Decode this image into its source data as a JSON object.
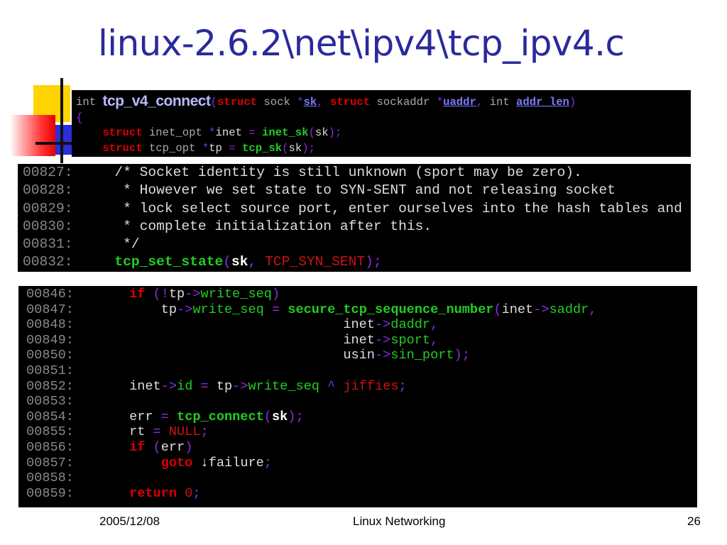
{
  "title": "linux-2.6.2\\net\\ipv4\\tcp_ipv4.c",
  "colors": {
    "title": "#2a2a9c",
    "code_background": "#000000",
    "keyword": "#dd0000",
    "function": "#22cc22",
    "identifier": "#dddddd",
    "operator": "#8a2be2",
    "constant": "#cc1111",
    "comment": "#dddddd",
    "line_number": "#888888",
    "link": "#7a7aff"
  },
  "code_top": {
    "lines": [
      [
        {
          "t": "int ",
          "k": "gray"
        },
        {
          "t": "tcp_v4_connect",
          "k": "fnbig"
        },
        {
          "t": "(",
          "k": "punct"
        },
        {
          "t": "struct",
          "k": "kw"
        },
        {
          "t": " sock ",
          "k": "gray"
        },
        {
          "t": "*",
          "k": "punct"
        },
        {
          "t": "sk",
          "k": "link"
        },
        {
          "t": ", ",
          "k": "punct"
        },
        {
          "t": "struct",
          "k": "kw"
        },
        {
          "t": " sockaddr ",
          "k": "gray"
        },
        {
          "t": "*",
          "k": "punct"
        },
        {
          "t": "uaddr",
          "k": "link"
        },
        {
          "t": ", ",
          "k": "punct"
        },
        {
          "t": "int ",
          "k": "gray"
        },
        {
          "t": "addr_len",
          "k": "link"
        },
        {
          "t": ")",
          "k": "punct"
        }
      ],
      [
        {
          "t": "{",
          "k": "punct"
        }
      ],
      [
        {
          "t": "    ",
          "k": "gray"
        },
        {
          "t": "struct",
          "k": "kw"
        },
        {
          "t": " inet_opt ",
          "k": "gray"
        },
        {
          "t": "*",
          "k": "punct"
        },
        {
          "t": "inet",
          "k": "ident"
        },
        {
          "t": " = ",
          "k": "punct"
        },
        {
          "t": "inet_sk",
          "k": "fn"
        },
        {
          "t": "(",
          "k": "punct"
        },
        {
          "t": "sk",
          "k": "ident"
        },
        {
          "t": ");",
          "k": "punct"
        }
      ],
      [
        {
          "t": "    ",
          "k": "gray"
        },
        {
          "t": "struct",
          "k": "kw"
        },
        {
          "t": " tcp_opt ",
          "k": "gray"
        },
        {
          "t": "*",
          "k": "punct"
        },
        {
          "t": "tp",
          "k": "ident"
        },
        {
          "t": " = ",
          "k": "punct"
        },
        {
          "t": "tcp_sk",
          "k": "fn"
        },
        {
          "t": "(",
          "k": "punct"
        },
        {
          "t": "sk",
          "k": "ident"
        },
        {
          "t": ");",
          "k": "punct"
        }
      ]
    ]
  },
  "code_middle": {
    "lines": [
      [
        {
          "t": "00827:",
          "k": "num"
        },
        {
          "t": "     /* Socket identity is still unknown (sport may be zero).",
          "k": "cmt"
        }
      ],
      [
        {
          "t": "00828:",
          "k": "num"
        },
        {
          "t": "      * However we set state to SYN-SENT and not releasing socket",
          "k": "cmt"
        }
      ],
      [
        {
          "t": "00829:",
          "k": "num"
        },
        {
          "t": "      * lock select source port, enter ourselves into the hash tables and",
          "k": "cmt"
        }
      ],
      [
        {
          "t": "00830:",
          "k": "num"
        },
        {
          "t": "      * complete initialization after this.",
          "k": "cmt"
        }
      ],
      [
        {
          "t": "00831:",
          "k": "num"
        },
        {
          "t": "      */",
          "k": "cmt"
        }
      ],
      [
        {
          "t": "00832:",
          "k": "num"
        },
        {
          "t": "     ",
          "k": "gray"
        },
        {
          "t": "tcp_set_state",
          "k": "fn"
        },
        {
          "t": "(",
          "k": "punct"
        },
        {
          "t": "sk",
          "k": "identw"
        },
        {
          "t": ", ",
          "k": "punct"
        },
        {
          "t": "TCP_SYN_SENT",
          "k": "const"
        },
        {
          "t": ");",
          "k": "punct"
        }
      ]
    ]
  },
  "code_bottom": {
    "lines": [
      [
        {
          "t": "00846:",
          "k": "num"
        },
        {
          "t": "       ",
          "k": "gray"
        },
        {
          "t": "if",
          "k": "kw"
        },
        {
          "t": " (",
          "k": "punct"
        },
        {
          "t": "!",
          "k": "punct"
        },
        {
          "t": "tp",
          "k": "ident"
        },
        {
          "t": "->",
          "k": "op"
        },
        {
          "t": "write_seq",
          "k": "member"
        },
        {
          "t": ")",
          "k": "punct"
        }
      ],
      [
        {
          "t": "00847:",
          "k": "num"
        },
        {
          "t": "           ",
          "k": "gray"
        },
        {
          "t": "tp",
          "k": "ident"
        },
        {
          "t": "->",
          "k": "op"
        },
        {
          "t": "write_seq",
          "k": "member"
        },
        {
          "t": " = ",
          "k": "op"
        },
        {
          "t": "secure_tcp_sequence_number",
          "k": "fn"
        },
        {
          "t": "(",
          "k": "punct"
        },
        {
          "t": "inet",
          "k": "ident"
        },
        {
          "t": "->",
          "k": "op"
        },
        {
          "t": "saddr",
          "k": "member"
        },
        {
          "t": ",",
          "k": "punct"
        }
      ],
      [
        {
          "t": "00848:",
          "k": "num"
        },
        {
          "t": "                                  ",
          "k": "gray"
        },
        {
          "t": "inet",
          "k": "ident"
        },
        {
          "t": "->",
          "k": "op"
        },
        {
          "t": "daddr",
          "k": "member"
        },
        {
          "t": ",",
          "k": "punct"
        }
      ],
      [
        {
          "t": "00849:",
          "k": "num"
        },
        {
          "t": "                                  ",
          "k": "gray"
        },
        {
          "t": "inet",
          "k": "ident"
        },
        {
          "t": "->",
          "k": "op"
        },
        {
          "t": "sport",
          "k": "member"
        },
        {
          "t": ",",
          "k": "punct"
        }
      ],
      [
        {
          "t": "00850:",
          "k": "num"
        },
        {
          "t": "                                  ",
          "k": "gray"
        },
        {
          "t": "usin",
          "k": "ident"
        },
        {
          "t": "->",
          "k": "op"
        },
        {
          "t": "sin_port",
          "k": "member"
        },
        {
          "t": ");",
          "k": "punct"
        }
      ],
      [
        {
          "t": "00851:",
          "k": "num"
        }
      ],
      [
        {
          "t": "00852:",
          "k": "num"
        },
        {
          "t": "       ",
          "k": "gray"
        },
        {
          "t": "inet",
          "k": "ident"
        },
        {
          "t": "->",
          "k": "op"
        },
        {
          "t": "id",
          "k": "member"
        },
        {
          "t": " = ",
          "k": "op"
        },
        {
          "t": "tp",
          "k": "ident"
        },
        {
          "t": "->",
          "k": "op"
        },
        {
          "t": "write_seq",
          "k": "member"
        },
        {
          "t": " ^ ",
          "k": "op"
        },
        {
          "t": "jiffies",
          "k": "const"
        },
        {
          "t": ";",
          "k": "punct"
        }
      ],
      [
        {
          "t": "00853:",
          "k": "num"
        }
      ],
      [
        {
          "t": "00854:",
          "k": "num"
        },
        {
          "t": "       ",
          "k": "gray"
        },
        {
          "t": "err",
          "k": "ident"
        },
        {
          "t": " = ",
          "k": "op"
        },
        {
          "t": "tcp_connect",
          "k": "fn"
        },
        {
          "t": "(",
          "k": "punct"
        },
        {
          "t": "sk",
          "k": "identw"
        },
        {
          "t": ");",
          "k": "punct"
        }
      ],
      [
        {
          "t": "00855:",
          "k": "num"
        },
        {
          "t": "       ",
          "k": "gray"
        },
        {
          "t": "rt",
          "k": "ident"
        },
        {
          "t": " = ",
          "k": "op"
        },
        {
          "t": "NULL",
          "k": "const"
        },
        {
          "t": ";",
          "k": "punct"
        }
      ],
      [
        {
          "t": "00856:",
          "k": "num"
        },
        {
          "t": "       ",
          "k": "gray"
        },
        {
          "t": "if",
          "k": "kw"
        },
        {
          "t": " (",
          "k": "punct"
        },
        {
          "t": "err",
          "k": "ident"
        },
        {
          "t": ")",
          "k": "punct"
        }
      ],
      [
        {
          "t": "00857:",
          "k": "num"
        },
        {
          "t": "           ",
          "k": "gray"
        },
        {
          "t": "goto",
          "k": "kw"
        },
        {
          "t": " ",
          "k": "gray"
        },
        {
          "t": "↓",
          "k": "arrow"
        },
        {
          "t": "failure",
          "k": "ident"
        },
        {
          "t": ";",
          "k": "punct"
        }
      ],
      [
        {
          "t": "00858:",
          "k": "num"
        }
      ],
      [
        {
          "t": "00859:",
          "k": "num"
        },
        {
          "t": "       ",
          "k": "gray"
        },
        {
          "t": "return",
          "k": "kw"
        },
        {
          "t": " ",
          "k": "gray"
        },
        {
          "t": "0",
          "k": "const"
        },
        {
          "t": ";",
          "k": "punct"
        }
      ]
    ]
  },
  "footer": {
    "date": "2005/12/08",
    "title": "Linux Networking",
    "page": "26"
  }
}
